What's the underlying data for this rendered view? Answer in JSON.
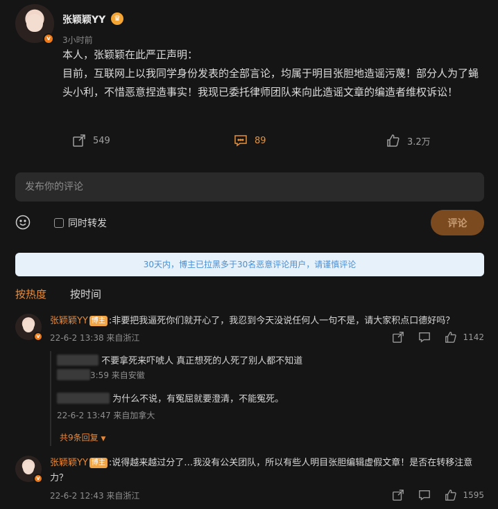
{
  "post": {
    "author": "张颖颖YY",
    "time": "3小时前",
    "text": "本人，张颖颖在此严正声明：\n目前，互联网上以我同学身份发表的全部言论，均属于明目张胆地造谣污蔑！部分人为了蝇头小利，不惜恶意捏造事实！我现已委托律师团队来向此造谣文章的编造者维权诉讼！",
    "reposts": "549",
    "comments": "89",
    "likes": "3.2万"
  },
  "composer": {
    "placeholder": "发布你的评论",
    "forward_label": "同时转发",
    "submit_label": "评论"
  },
  "notice": "30天内，博主已拉黑多于30名恶意评论用户，请谨慎评论",
  "sort": {
    "hot": "按热度",
    "time": "按时间"
  },
  "comments": [
    {
      "user": "张颖颖YY",
      "badge": "博主",
      "text": ":非要把我逼死你们就开心了，我忍到今天没说任何人一句不是，请大家积点口德好吗？",
      "meta": "22-6-2 13:38 来自浙江",
      "likes": "1142",
      "replies": [
        {
          "text": "不要拿死来吓唬人 真正想死的人死了别人都不知道",
          "meta": "3:59 来自安徽"
        },
        {
          "text": "为什么不说，有冤屈就要澄清，不能冤死。",
          "meta": "22-6-2 13:47 来自加拿大"
        }
      ],
      "more_replies": "共9条回复"
    },
    {
      "user": "张颖颖YY",
      "badge": "博主",
      "text": ":说得越来越过分了…我没有公关团队，所以有些人明目张胆编辑虚假文章！是否在转移注意力？",
      "meta": "22-6-2 12:43 来自浙江",
      "likes": "1595"
    }
  ],
  "colors": {
    "accent": "#ef8d35",
    "bg": "#151515",
    "notice_bg": "#e6f1fa",
    "notice_text": "#4b8fd3"
  }
}
